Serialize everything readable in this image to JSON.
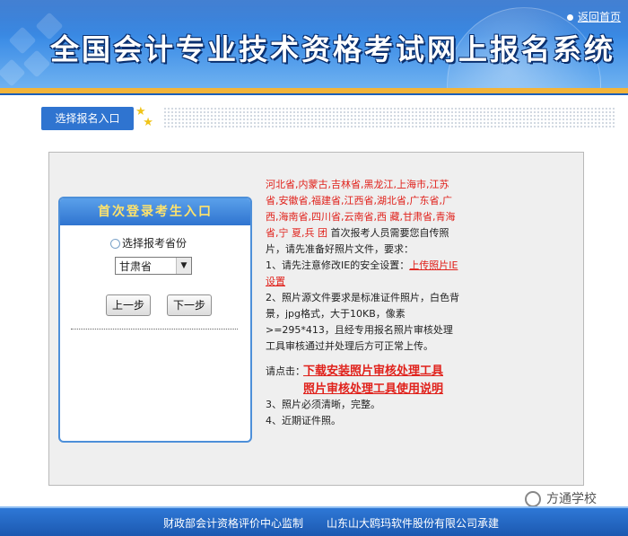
{
  "header": {
    "title": "全国会计专业技术资格考试网上报名系统",
    "home_link": "返回首页"
  },
  "nav": {
    "tab_label": "选择报名入口"
  },
  "login": {
    "heading": "首次登录考生入口",
    "radio_label": "选择报考省份",
    "province_selected": "甘肃省",
    "prev_button": "上一步",
    "next_button": "下一步"
  },
  "info": {
    "provinces": "河北省,内蒙古,吉林省,黑龙江,上海市,江苏省,安徽省,福建省,江西省,湖北省,广东省,广 西,海南省,四川省,云南省,西 藏,甘肃省,青海省,宁 夏,兵 团",
    "intro": "首次报考人员需要您自传照片，请先准备好照片文件，要求：",
    "item1_prefix": "1、请先注意修改IE的安全设置：",
    "item1_link": "上传照片IE设置",
    "item2": "2、照片源文件要求是标准证件照片，白色背景，jpg格式，大于10KB，像素>=295*413，且经专用报名照片审核处理工具审核通过并处理后方可正常上传。",
    "click_label": "请点击：",
    "link_download": "下载安装照片审核处理工具",
    "link_manual": "照片审核处理工具使用说明",
    "item3": "3、照片必须清晰，完整。",
    "item4": "4、近期证件照。"
  },
  "footer": {
    "left": "财政部会计资格评价中心监制",
    "right": "山东山大鸥玛软件股份有限公司承建"
  },
  "watermark": "方通学校",
  "colors": {
    "banner_blue": "#2f74d0",
    "accent_red": "#e0211b",
    "stripe_orange": "#f3b43a"
  }
}
